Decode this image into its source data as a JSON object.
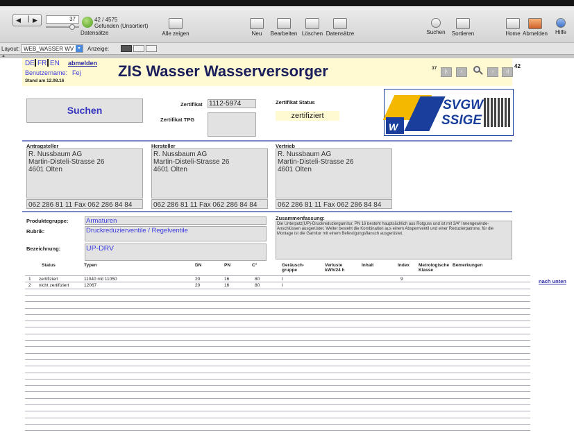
{
  "toolbar": {
    "record_current": "37",
    "record_counts": "42 / 4575",
    "found_label": "Gefunden (Unsortiert)",
    "records_label": "Datensätze",
    "show_all": "Alle zeigen",
    "new": "Neu",
    "edit": "Bearbeiten",
    "delete": "Löschen",
    "records_menu": "Datensätze",
    "search": "Suchen",
    "sort": "Sortieren",
    "home": "Home",
    "logout": "Abmelden",
    "help": "Hilfe"
  },
  "layoutbar": {
    "layout_label": "Layout:",
    "layout_value": "WEB_WASSER WV",
    "view_label": "Anzeige:"
  },
  "header": {
    "lang_de": "DE",
    "lang_fr": "FR",
    "lang_en": "EN",
    "logout_link": "abmelden",
    "username_label": "Benutzername:",
    "username": "Fej",
    "date": "Stand am 12.08.16",
    "title": "ZIS Wasser Wasserversorger",
    "nav_current": "37",
    "nav_total": "42"
  },
  "search_button": "Suchen",
  "zertifikat": {
    "label": "Zertifikat",
    "value": "1112-5974",
    "tpg_label": "Zertifikat TPG",
    "status_label": "Zertifikat Status",
    "status_value": "zertifiziert"
  },
  "logo": {
    "text1": "SVGW",
    "text2": "SSIGE",
    "w": "W"
  },
  "antragsteller": {
    "label": "Antragsteller",
    "name": "R. Nussbaum AG",
    "street": "Martin-Disteli-Strasse 26",
    "city": "4601 Olten",
    "phone": "062 286 81 11  Fax 062 286 84 84"
  },
  "hersteller": {
    "label": "Hersteller",
    "name": "R. Nussbaum AG",
    "street": "Martin-Disteli-Strasse 26",
    "city": "4601 Olten",
    "phone": "062 286 81 11  Fax 062 286 84 84"
  },
  "vertrieb": {
    "label": "Vertrieb",
    "name": "R. Nussbaum AG",
    "street": "Martin-Disteli-Strasse 26",
    "city": "4601 Olten",
    "phone": "062 286 81 11  Fax 062 286 84 84"
  },
  "product": {
    "gruppe_label": "Produktegruppe:",
    "gruppe_value": "Armaturen",
    "rubrik_label": "Rubrik:",
    "rubrik_value": "Druckreduzierventile / Regelventile",
    "bezeichnung_label": "Bezeichnung:",
    "bezeichnung_value": "UP-DRV",
    "summary_label": "Zusammenfassung:",
    "summary_text": "Die Unterputz(UP)-Druckreduziergarnitur, PN 16 besteht hauptsächlich aus Rotguss und ist mit 3/4\" Innengewinde-Anschlüssen ausgerüstet. Weiter besteht die Kombination aus einem Absperrventil und einer Reduzierpatrone, für die Montage ist die  Garnitur mit einem  Befestigungsflansch ausgerüstet."
  },
  "table": {
    "headers": {
      "status": "Status",
      "typen": "Typen",
      "dn": "DN",
      "pn": "PN",
      "c": "C°",
      "geraeusch": "Geräusch-",
      "gruppe": "gruppe",
      "verluste": "Verluste",
      "kwh": "kWh/24 h",
      "inhalt": "Inhalt",
      "index": "Index",
      "metro": "Metrologische",
      "klasse": "Klasse",
      "bemerkungen": "Bemerkungen"
    },
    "rows": [
      {
        "nr": "1",
        "status": "zertifiziert",
        "typen": "11040 mit 11050",
        "dn": "20",
        "pn": "16",
        "c": "80",
        "g": "I",
        "index": "9"
      },
      {
        "nr": "2",
        "status": "nicht zertifiziert",
        "typen": "12067",
        "dn": "20",
        "pn": "16",
        "c": "80",
        "g": "I",
        "index": ""
      }
    ],
    "nach_unten": "nach unten"
  }
}
